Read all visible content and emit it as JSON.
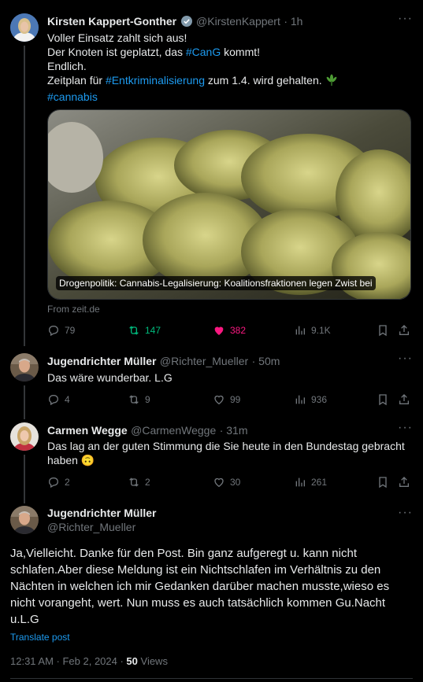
{
  "tweet1": {
    "author_name": "Kirsten Kappert-Gonther",
    "handle": "@KirstenKappert",
    "time": "· 1h",
    "line1": "Voller Einsatz zahlt sich aus!",
    "line2_pre": "Der Knoten ist geplatzt, das ",
    "line2_tag": "#CanG",
    "line2_post": " kommt!",
    "line3": "Endlich.",
    "line4_pre": "Zeitplan für ",
    "line4_tag": "#Entkriminalisierung",
    "line4_post": " zum 1.4. wird gehalten.",
    "line5_tag": "#cannabis",
    "card_caption": "Drogenpolitik: Cannabis-Legalisierung: Koalitionsfraktionen legen Zwist bei",
    "card_source": "From zeit.de",
    "replies": "79",
    "reposts": "147",
    "likes": "382",
    "views": "9.1K"
  },
  "tweet2": {
    "author_name": "Jugendrichter Müller",
    "handle": "@Richter_Mueller",
    "time": "· 50m",
    "text": "Das wäre wunderbar. L.G",
    "replies": "4",
    "reposts": "9",
    "likes": "99",
    "views": "936"
  },
  "tweet3": {
    "author_name": "Carmen Wegge",
    "handle": "@CarmenWegge",
    "time": "· 31m",
    "text_line1": "Das lag an der guten Stimmung die Sie heute in den Bundestag gebracht",
    "text_line2": "haben 🙃",
    "replies": "2",
    "reposts": "2",
    "likes": "30",
    "views": "261"
  },
  "main_tweet": {
    "author_name": "Jugendrichter Müller",
    "handle": "@Richter_Mueller",
    "text": "Ja,Vielleicht. Danke für den Post. Bin ganz aufgeregt u. kann nicht schlafen.Aber diese Meldung ist ein Nichtschlafen im Verhältnis zu den Nächten in welchen ich mir  Gedanken darüber machen musste,wieso es nicht vorangeht, wert. Nun muss es auch tatsächlich kommen Gu.Nacht u.L.G",
    "translate": "Translate post",
    "timestamp": "12:31 AM · Feb 2, 2024 · ",
    "views_count": "50",
    "views_label": " Views"
  },
  "colors": {
    "background": "#000000",
    "text": "#e7e9ea",
    "muted": "#71767b",
    "link": "#1d9bf0",
    "repost": "#00ba7c",
    "like": "#f91880"
  }
}
